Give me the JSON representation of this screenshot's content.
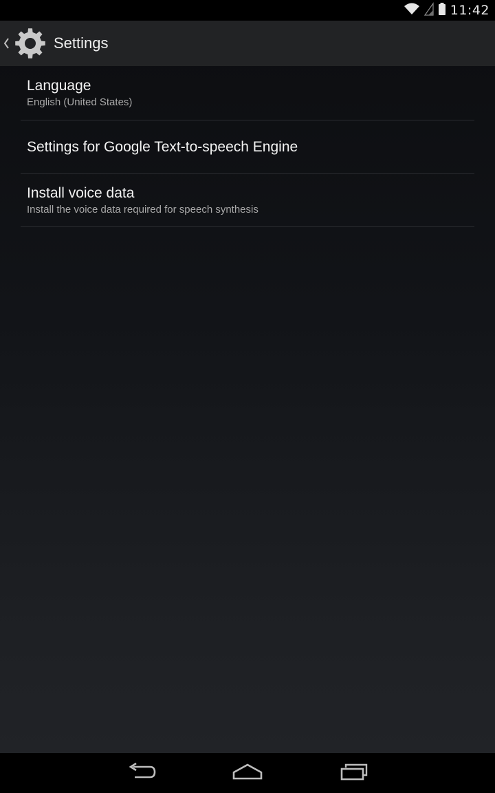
{
  "status_bar": {
    "time": "11:42",
    "icons": [
      "wifi-icon",
      "signal-icon",
      "battery-icon"
    ]
  },
  "action_bar": {
    "title": "Settings",
    "icon": "gear-icon",
    "up_icon": "chevron-left-icon"
  },
  "preferences": [
    {
      "title": "Language",
      "summary": "English (United States)"
    },
    {
      "title": "Settings for Google Text-to-speech Engine",
      "summary": ""
    },
    {
      "title": "Install voice data",
      "summary": "Install the voice data required for speech synthesis"
    }
  ],
  "nav_bar": {
    "buttons": [
      "back-icon",
      "home-icon",
      "recents-icon"
    ]
  },
  "colors": {
    "background": "#121418",
    "action_bar": "#222325",
    "divider": "#2b2d31",
    "primary_text": "#f2f2f2",
    "secondary_text": "#a8a8a8"
  }
}
